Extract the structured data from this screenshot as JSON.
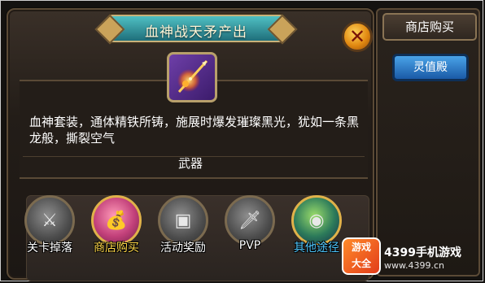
{
  "dialog": {
    "title": "血神战天矛产出",
    "close_icon": "close-x-icon",
    "item_icon": "spear-icon",
    "description": "血神套装，通体精铁所铸，施展时爆发璀璨黑光，犹如一条黑龙般，撕裂空气",
    "category": "武器"
  },
  "sources": [
    {
      "label": "关卡掉落",
      "icon": "crossed-swords-icon"
    },
    {
      "label": "商店购买",
      "icon": "money-bag-icon"
    },
    {
      "label": "活动奖励",
      "icon": "treasure-chest-icon"
    },
    {
      "label": "PVP",
      "icon": "pvp-sword-icon"
    },
    {
      "label": "其他途径",
      "icon": "peacock-feather-icon"
    }
  ],
  "sidebar": {
    "header": "商店购买",
    "button": "灵值殿"
  },
  "watermark": {
    "badge_line1": "游戏",
    "badge_line2": "大全",
    "brand": "4399手机游戏",
    "url": "www.4399.cn"
  }
}
